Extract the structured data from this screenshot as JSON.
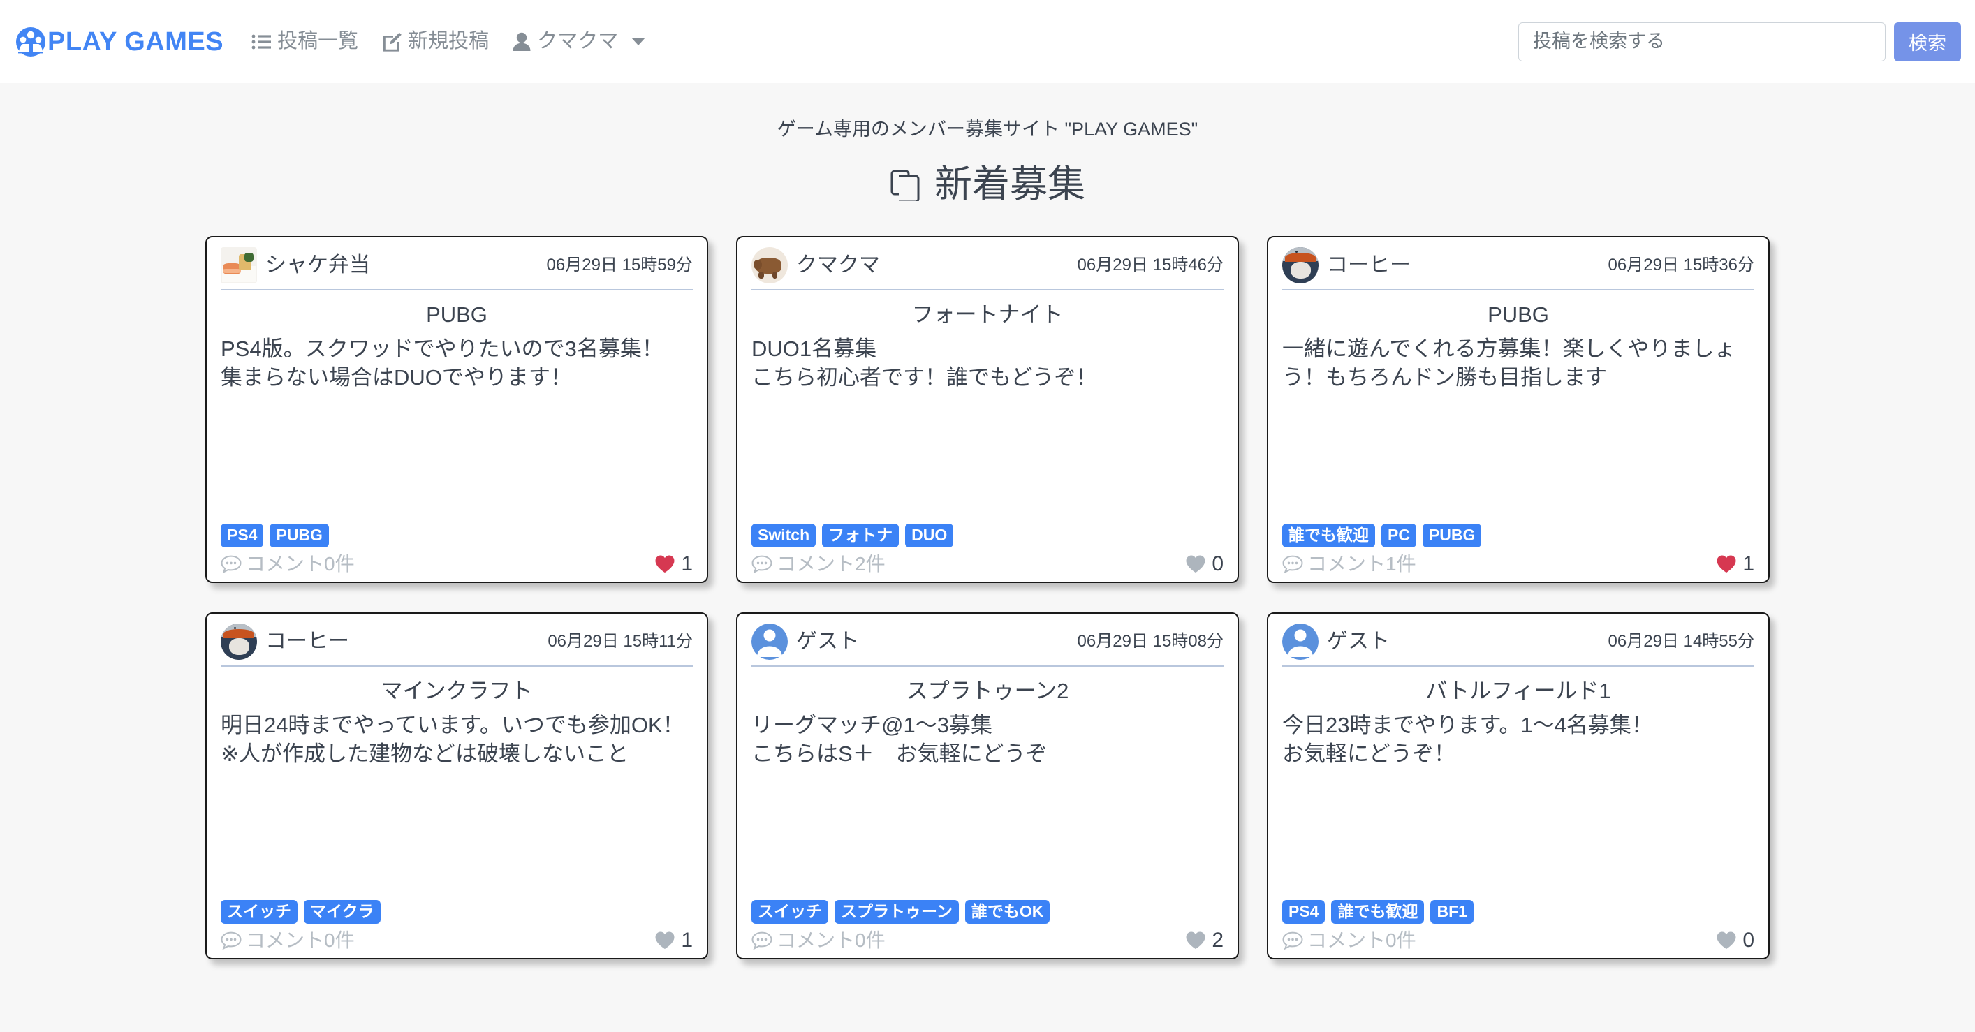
{
  "header": {
    "brand": "PLAY GAMES",
    "brand_color": "#4285f4",
    "nav": [
      {
        "label": "投稿一覧",
        "icon": "list-icon"
      },
      {
        "label": "新規投稿",
        "icon": "pencil-square-icon"
      },
      {
        "label": "クマクマ",
        "icon": "user-icon",
        "has_caret": true
      }
    ],
    "search": {
      "placeholder": "投稿を検索する",
      "value": "",
      "button_label": "検索",
      "button_color": "#7593e8"
    }
  },
  "page": {
    "tagline": "ゲーム専用のメンバー募集サイト \"PLAY GAMES\"",
    "title": "新着募集",
    "title_icon": "copy-icon"
  },
  "colors": {
    "tag_blue": "#3b82f6",
    "heart_red": "#d63851",
    "heart_gray": "#adb5bd",
    "page_bg": "#f7f7f7",
    "card_border": "#1a1a1a",
    "divider": "#b9c7dd"
  },
  "posts": [
    {
      "author": "シャケ弁当",
      "avatar": "bento-photo",
      "avatar_shape": "square",
      "timestamp": "06月29日 15時59分",
      "title": "PUBG",
      "body": "PS4版。スクワッドでやりたいので3名募集！\n集まらない場合はDUOでやります！",
      "tags": [
        "PS4",
        "PUBG"
      ],
      "comments_label": "コメント0件",
      "comment_count": 0,
      "like_count": 1,
      "liked": true
    },
    {
      "author": "クマクマ",
      "avatar": "bear-photo",
      "avatar_shape": "circle",
      "timestamp": "06月29日 15時46分",
      "title": "フォートナイト",
      "body": "DUO1名募集\nこちら初心者です！誰でもどうぞ！",
      "tags": [
        "Switch",
        "フォトナ",
        "DUO"
      ],
      "comments_label": "コメント2件",
      "comment_count": 2,
      "like_count": 0,
      "liked": false
    },
    {
      "author": "コーヒー",
      "avatar": "cat-photo",
      "avatar_shape": "circle",
      "timestamp": "06月29日 15時36分",
      "title": "PUBG",
      "body": "一緒に遊んでくれる方募集！楽しくやりましょう！もちろんドン勝も目指します",
      "tags": [
        "誰でも歓迎",
        "PC",
        "PUBG"
      ],
      "comments_label": "コメント1件",
      "comment_count": 1,
      "like_count": 1,
      "liked": true
    },
    {
      "author": "コーヒー",
      "avatar": "cat-photo",
      "avatar_shape": "circle",
      "timestamp": "06月29日 15時11分",
      "title": "マインクラフト",
      "body": "明日24時までやっています。いつでも参加OK！\n※人が作成した建物などは破壊しないこと",
      "tags": [
        "スイッチ",
        "マイクラ"
      ],
      "comments_label": "コメント0件",
      "comment_count": 0,
      "like_count": 1,
      "liked": false
    },
    {
      "author": "ゲスト",
      "avatar": "guest-icon",
      "avatar_shape": "circle",
      "timestamp": "06月29日 15時08分",
      "title": "スプラトゥーン2",
      "body": "リーグマッチ@1〜3募集\nこちらはS＋　お気軽にどうぞ",
      "tags": [
        "スイッチ",
        "スプラトゥーン",
        "誰でもOK"
      ],
      "comments_label": "コメント0件",
      "comment_count": 0,
      "like_count": 2,
      "liked": false
    },
    {
      "author": "ゲスト",
      "avatar": "guest-icon",
      "avatar_shape": "circle",
      "timestamp": "06月29日 14時55分",
      "title": "バトルフィールド1",
      "body": "今日23時までやります。1〜4名募集！\nお気軽にどうぞ！",
      "tags": [
        "PS4",
        "誰でも歓迎",
        "BF1"
      ],
      "comments_label": "コメント0件",
      "comment_count": 0,
      "like_count": 0,
      "liked": false
    }
  ]
}
